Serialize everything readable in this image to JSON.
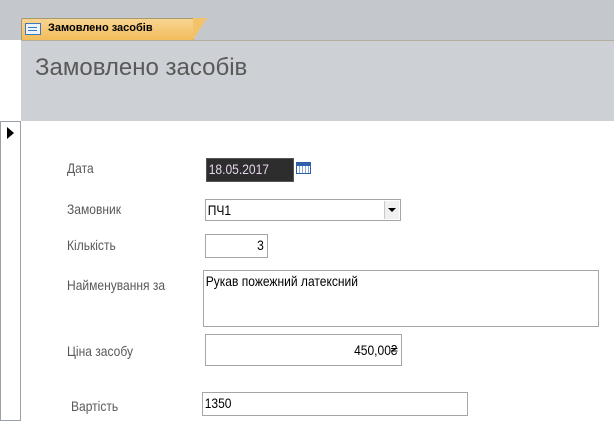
{
  "tab": {
    "icon": "form-icon",
    "label": "Замовлено засобів"
  },
  "header": {
    "title": "Замовлено засобів"
  },
  "record_selector": {
    "icon": "current-record-arrow-icon"
  },
  "form": {
    "date": {
      "label": "Дата",
      "value": "18.05.2017",
      "picker_icon": "calendar-icon"
    },
    "customer": {
      "label": "Замовник",
      "value": "ПЧ1",
      "dropdown_icon": "chevron-down-icon"
    },
    "quantity": {
      "label": "Кількість",
      "value": "3"
    },
    "item_name": {
      "label": "Найменування за",
      "value": "Рукав пожежний латексний"
    },
    "price": {
      "label": "Ціна засобу",
      "value": "450,00₴"
    },
    "cost": {
      "label": "Вартість",
      "value": "1350"
    }
  }
}
